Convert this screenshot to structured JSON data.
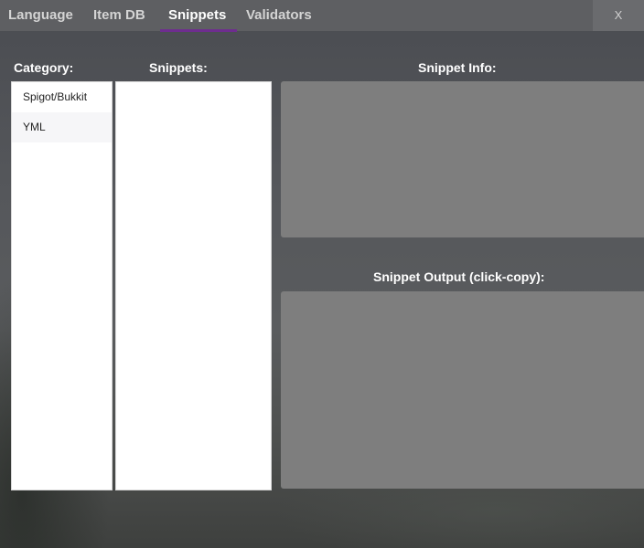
{
  "tabs": [
    {
      "label": "Language"
    },
    {
      "label": "Item DB"
    },
    {
      "label": "Snippets",
      "active": true
    },
    {
      "label": "Validators"
    }
  ],
  "window": {
    "close_label": "X"
  },
  "category": {
    "heading": "Category:",
    "items": [
      {
        "label": "Spigot/Bukkit"
      },
      {
        "label": "YML"
      }
    ]
  },
  "snippets": {
    "heading": "Snippets:"
  },
  "snippet_info": {
    "heading": "Snippet Info:"
  },
  "snippet_output": {
    "heading": "Snippet Output (click-copy):"
  },
  "colors": {
    "accent": "#6e2d8f",
    "panel_gray": "#7e7e7e"
  }
}
